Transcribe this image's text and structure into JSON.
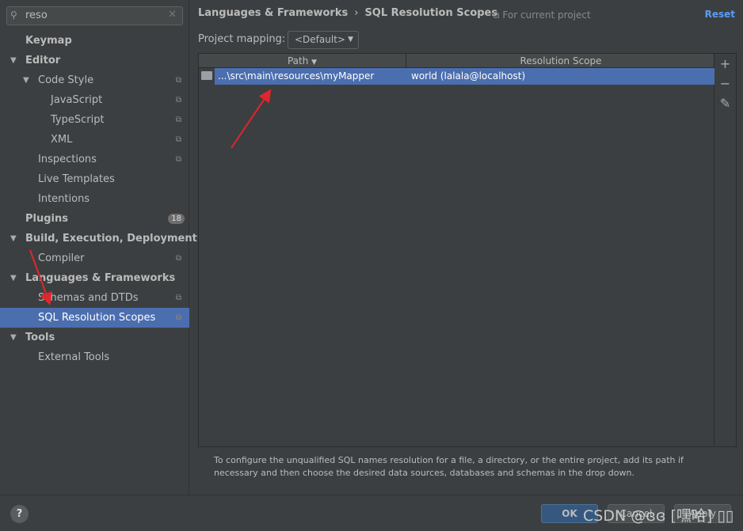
{
  "search": {
    "value": "reso"
  },
  "sidebar": {
    "items": [
      {
        "label": "Keymap",
        "bold": true,
        "level": 0
      },
      {
        "label": "Editor",
        "bold": true,
        "level": 0,
        "expanded": true
      },
      {
        "label": "Code Style",
        "level": 1,
        "expanded": true,
        "copy": true
      },
      {
        "label": "JavaScript",
        "level": 2,
        "copy": true
      },
      {
        "label": "TypeScript",
        "level": 2,
        "copy": true
      },
      {
        "label": "XML",
        "level": 2,
        "copy": true
      },
      {
        "label": "Inspections",
        "level": 1,
        "copy": true
      },
      {
        "label": "Live Templates",
        "level": 1
      },
      {
        "label": "Intentions",
        "level": 1
      },
      {
        "label": "Plugins",
        "bold": true,
        "level": 0,
        "badge": "18"
      },
      {
        "label": "Build, Execution, Deployment",
        "bold": true,
        "level": 0,
        "expanded": true
      },
      {
        "label": "Compiler",
        "level": 1,
        "copy": true
      },
      {
        "label": "Languages & Frameworks",
        "bold": true,
        "level": 0,
        "expanded": true
      },
      {
        "label": "Schemas and DTDs",
        "level": 1,
        "copy": true
      },
      {
        "label": "SQL Resolution Scopes",
        "level": 1,
        "copy": true,
        "selected": true
      },
      {
        "label": "Tools",
        "bold": true,
        "level": 0,
        "expanded": true
      },
      {
        "label": "External Tools",
        "level": 1
      }
    ]
  },
  "header": {
    "breadcrumb_parent": "Languages & Frameworks",
    "breadcrumb_current": "SQL Resolution Scopes",
    "scope_note": "For current project",
    "reset": "Reset"
  },
  "mapping": {
    "label": "Project mapping:",
    "value": "<Default>"
  },
  "table": {
    "columns": [
      "Path",
      "Resolution Scope"
    ],
    "rows": [
      {
        "path": "...\\src\\main\\resources\\myMapper",
        "scope": "world (lalala@localhost)"
      }
    ]
  },
  "help_text": "To configure the unqualified SQL names resolution for a file, a directory, or the entire project, add its path if necessary and then choose the desired data sources, databases and schemas in the drop down.",
  "footer": {
    "help": "?",
    "ok": "OK",
    "cancel": "Cancel",
    "apply": "Apply"
  },
  "watermark": "CSDN @ɞɞ [嘿哈] ▯▯",
  "colors": {
    "selection": "#4b6eaf",
    "link": "#589df6",
    "annotation_arrow": "#e0262b"
  }
}
